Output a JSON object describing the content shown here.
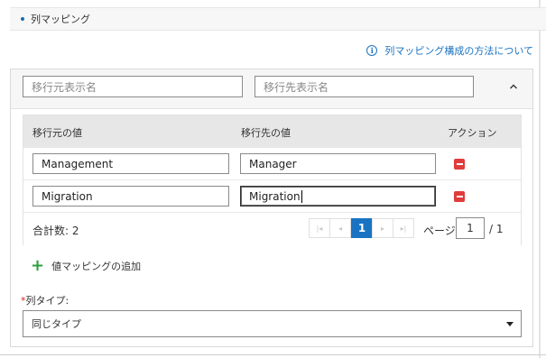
{
  "section": {
    "title": "列マッピング"
  },
  "help": {
    "icon": "info-icon",
    "text": "列マッピング構成の方法について"
  },
  "filters": {
    "source_placeholder": "移行元表示名",
    "target_placeholder": "移行先表示名"
  },
  "table": {
    "headers": {
      "source": "移行元の値",
      "target": "移行先の値",
      "action": "アクション"
    },
    "rows": [
      {
        "source": "Management",
        "target": "Manager"
      },
      {
        "source": "Migration",
        "target": "Migration"
      }
    ]
  },
  "pager": {
    "total_label": "合計数: 2",
    "first": "|◂",
    "prev": "◂",
    "current": "1",
    "next": "▸",
    "last": "▸|",
    "page_label": "ページ",
    "page_value": "1",
    "of_label": "/ 1"
  },
  "add_mapping": {
    "label": "値マッピングの追加"
  },
  "column_type": {
    "required_mark": "*",
    "label": "列タイプ:",
    "selected": "同じタイプ"
  },
  "colors": {
    "accent": "#1a73c2",
    "delete": "#e03c3c",
    "add": "#2e9e3e",
    "required": "#d9261c"
  }
}
